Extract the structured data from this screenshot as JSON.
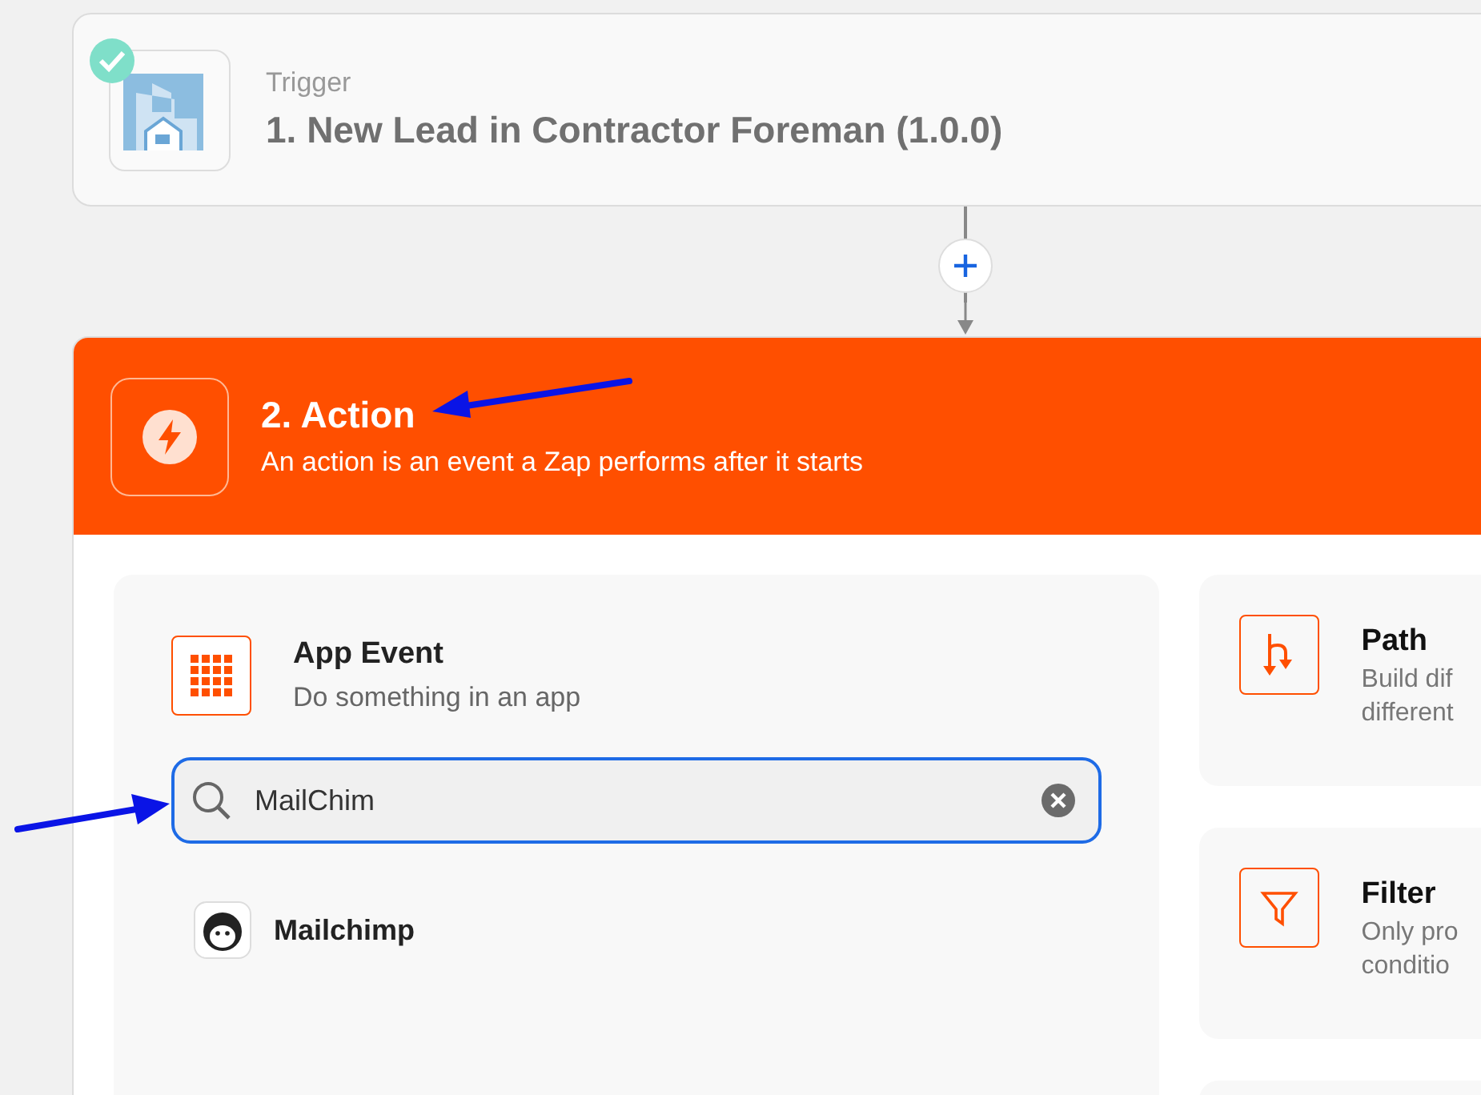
{
  "trigger": {
    "label": "Trigger",
    "title": "1. New Lead in Contractor Foreman (1.0.0)",
    "completed": true
  },
  "action": {
    "title": "2. Action",
    "subtitle": "An action is an event a Zap performs after it starts"
  },
  "app_event": {
    "title": "App Event",
    "subtitle": "Do something in an app"
  },
  "search": {
    "value": "MailChim"
  },
  "results": [
    {
      "name": "Mailchimp"
    }
  ],
  "options": [
    {
      "kind": "path",
      "title": "Path",
      "lines": [
        "Build dif",
        "different"
      ]
    },
    {
      "kind": "filter",
      "title": "Filter",
      "lines": [
        "Only pro",
        "conditio"
      ]
    }
  ]
}
